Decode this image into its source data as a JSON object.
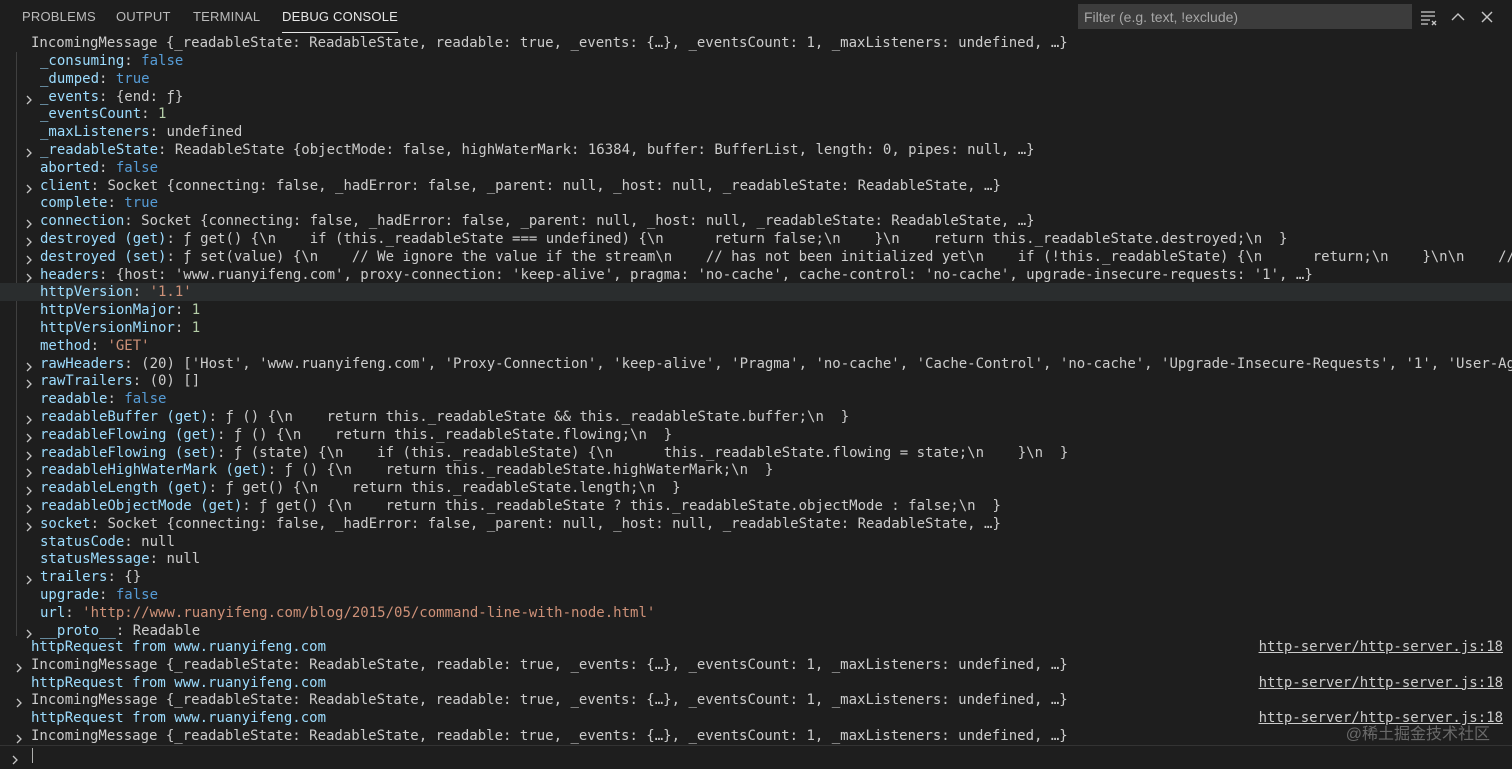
{
  "tabs": {
    "problems": "PROBLEMS",
    "output": "OUTPUT",
    "terminal": "TERMINAL",
    "debug_console": "DEBUG CONSOLE"
  },
  "filter": {
    "placeholder": "Filter (e.g. text, !exclude)",
    "value": ""
  },
  "icons": {
    "filter_menu": "list-filter-icon",
    "collapse": "chevron-up-icon",
    "close": "close-icon"
  },
  "root": {
    "label": "IncomingMessage {_readableState: ReadableState, readable: true, _events: {…}, _eventsCount: 1, _maxListeners: undefined, …}"
  },
  "properties": [
    {
      "key": "_consuming",
      "value": "false"
    },
    {
      "key": "_dumped",
      "value": "true"
    },
    {
      "key": "_events",
      "value": "{end: ƒ}"
    },
    {
      "key": "_eventsCount",
      "value": "1"
    },
    {
      "key": "_maxListeners",
      "value": "undefined"
    },
    {
      "key": "_readableState",
      "value": "ReadableState {objectMode: false, highWaterMark: 16384, buffer: BufferList, length: 0, pipes: null, …}"
    },
    {
      "key": "aborted",
      "value": "false"
    },
    {
      "key": "client",
      "value": "Socket {connecting: false, _hadError: false, _parent: null, _host: null, _readableState: ReadableState, …}"
    },
    {
      "key": "complete",
      "value": "true"
    },
    {
      "key": "connection",
      "value": "Socket {connecting: false, _hadError: false, _parent: null, _host: null, _readableState: ReadableState, …}"
    },
    {
      "key": "destroyed (get)",
      "value": "ƒ get() {\\n    if (this._readableState === undefined) {\\n      return false;\\n    }\\n    return this._readableState.destroyed;\\n  }"
    },
    {
      "key": "destroyed (set)",
      "value": "ƒ set(value) {\\n    // We ignore the value if the stream\\n    // has not been initialized yet\\n    if (!this._readableState) {\\n      return;\\n    }\\n\\n    // Backward"
    },
    {
      "key": "headers",
      "value": "{host: 'www.ruanyifeng.com', proxy-connection: 'keep-alive', pragma: 'no-cache', cache-control: 'no-cache', upgrade-insecure-requests: '1', …}"
    },
    {
      "key": "httpVersion",
      "value": "'1.1'"
    },
    {
      "key": "httpVersionMajor",
      "value": "1"
    },
    {
      "key": "httpVersionMinor",
      "value": "1"
    },
    {
      "key": "method",
      "value": "'GET'"
    },
    {
      "key": "rawHeaders",
      "value": "(20) ['Host', 'www.ruanyifeng.com', 'Proxy-Connection', 'keep-alive', 'Pragma', 'no-cache', 'Cache-Control', 'no-cache', 'Upgrade-Insecure-Requests', '1', 'User-Agent', 'Mo"
    },
    {
      "key": "rawTrailers",
      "value": "(0) []"
    },
    {
      "key": "readable",
      "value": "false"
    },
    {
      "key": "readableBuffer (get)",
      "value": "ƒ () {\\n    return this._readableState && this._readableState.buffer;\\n  }"
    },
    {
      "key": "readableFlowing (get)",
      "value": "ƒ () {\\n    return this._readableState.flowing;\\n  }"
    },
    {
      "key": "readableFlowing (set)",
      "value": "ƒ (state) {\\n    if (this._readableState) {\\n      this._readableState.flowing = state;\\n    }\\n  }"
    },
    {
      "key": "readableHighWaterMark (get)",
      "value": "ƒ () {\\n    return this._readableState.highWaterMark;\\n  }"
    },
    {
      "key": "readableLength (get)",
      "value": "ƒ get() {\\n    return this._readableState.length;\\n  }"
    },
    {
      "key": "readableObjectMode (get)",
      "value": "ƒ get() {\\n    return this._readableState ? this._readableState.objectMode : false;\\n  }"
    },
    {
      "key": "socket",
      "value": "Socket {connecting: false, _hadError: false, _parent: null, _host: null, _readableState: ReadableState, …}"
    },
    {
      "key": "statusCode",
      "value": "null"
    },
    {
      "key": "statusMessage",
      "value": "null"
    },
    {
      "key": "trailers",
      "value": "{}"
    },
    {
      "key": "upgrade",
      "value": "false"
    },
    {
      "key": "url",
      "value": "'http://www.ruanyifeng.com/blog/2015/05/command-line-with-node.html'"
    },
    {
      "key": "__proto__",
      "value": "Readable"
    }
  ],
  "log_entries": [
    {
      "message": "httpRequest from www.ruanyifeng.com",
      "source": "http-server/http-server.js:18",
      "object": "IncomingMessage {_readableState: ReadableState, readable: true, _events: {…}, _eventsCount: 1, _maxListeners: undefined, …}"
    },
    {
      "message": "httpRequest from www.ruanyifeng.com",
      "source": "http-server/http-server.js:18",
      "object": "IncomingMessage {_readableState: ReadableState, readable: true, _events: {…}, _eventsCount: 1, _maxListeners: undefined, …}"
    },
    {
      "message": "httpRequest from www.ruanyifeng.com",
      "source": "http-server/http-server.js:18",
      "object": "IncomingMessage {_readableState: ReadableState, readable: true, _events: {…}, _eventsCount: 1, _maxListeners: undefined, …}"
    }
  ],
  "watermark": "@稀土掘金技术社区",
  "colors": {
    "background": "#1e1e1e",
    "key": "#9cdcfe",
    "boolean": "#569cd6",
    "number": "#b5cea8",
    "string": "#ce9178",
    "text": "#cccccc"
  }
}
